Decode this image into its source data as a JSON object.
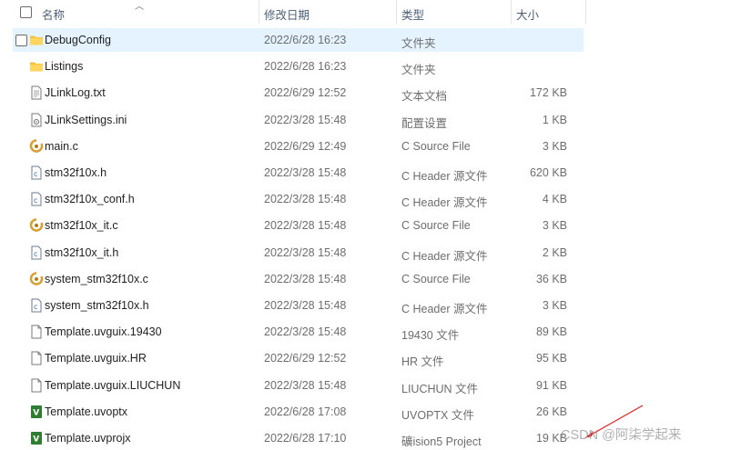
{
  "columns": {
    "name": "名称",
    "modified": "修改日期",
    "type": "类型",
    "size": "大小"
  },
  "files": [
    {
      "name": "DebugConfig",
      "modified": "2022/6/28 16:23",
      "type": "文件夹",
      "size": "",
      "icon": "folder-icon",
      "selected": true
    },
    {
      "name": "Listings",
      "modified": "2022/6/28 16:23",
      "type": "文件夹",
      "size": "",
      "icon": "folder-icon"
    },
    {
      "name": "JLinkLog.txt",
      "modified": "2022/6/29 12:52",
      "type": "文本文档",
      "size": "172 KB",
      "icon": "text-file-icon"
    },
    {
      "name": "JLinkSettings.ini",
      "modified": "2022/3/28 15:48",
      "type": "配置设置",
      "size": "1 KB",
      "icon": "settings-file-icon"
    },
    {
      "name": "main.c",
      "modified": "2022/6/29 12:49",
      "type": "C Source File",
      "size": "3 KB",
      "icon": "c-source-icon"
    },
    {
      "name": "stm32f10x.h",
      "modified": "2022/3/28 15:48",
      "type": "C Header 源文件",
      "size": "620 KB",
      "icon": "c-header-icon"
    },
    {
      "name": "stm32f10x_conf.h",
      "modified": "2022/3/28 15:48",
      "type": "C Header 源文件",
      "size": "4 KB",
      "icon": "c-header-icon"
    },
    {
      "name": "stm32f10x_it.c",
      "modified": "2022/3/28 15:48",
      "type": "C Source File",
      "size": "3 KB",
      "icon": "c-source-icon"
    },
    {
      "name": "stm32f10x_it.h",
      "modified": "2022/3/28 15:48",
      "type": "C Header 源文件",
      "size": "2 KB",
      "icon": "c-header-icon"
    },
    {
      "name": "system_stm32f10x.c",
      "modified": "2022/3/28 15:48",
      "type": "C Source File",
      "size": "36 KB",
      "icon": "c-source-icon"
    },
    {
      "name": "system_stm32f10x.h",
      "modified": "2022/3/28 15:48",
      "type": "C Header 源文件",
      "size": "3 KB",
      "icon": "c-header-icon"
    },
    {
      "name": "Template.uvguix.19430",
      "modified": "2022/3/28 15:48",
      "type": "19430 文件",
      "size": "89 KB",
      "icon": "generic-file-icon"
    },
    {
      "name": "Template.uvguix.HR",
      "modified": "2022/6/29 12:52",
      "type": "HR 文件",
      "size": "95 KB",
      "icon": "generic-file-icon"
    },
    {
      "name": "Template.uvguix.LIUCHUN",
      "modified": "2022/3/28 15:48",
      "type": "LIUCHUN 文件",
      "size": "91 KB",
      "icon": "generic-file-icon"
    },
    {
      "name": "Template.uvoptx",
      "modified": "2022/6/28 17:08",
      "type": "UVOPTX 文件",
      "size": "26 KB",
      "icon": "uvision-file-icon"
    },
    {
      "name": "Template.uvprojx",
      "modified": "2022/6/28 17:10",
      "type": "礦ision5 Project",
      "size": "19 KB",
      "icon": "uvision-file-icon"
    }
  ],
  "watermark": "CSDN @阿柒学起来",
  "colors": {
    "selected_row": "#e5f3ff",
    "folder": "#f5c342",
    "uvision": "#2f7d32"
  }
}
